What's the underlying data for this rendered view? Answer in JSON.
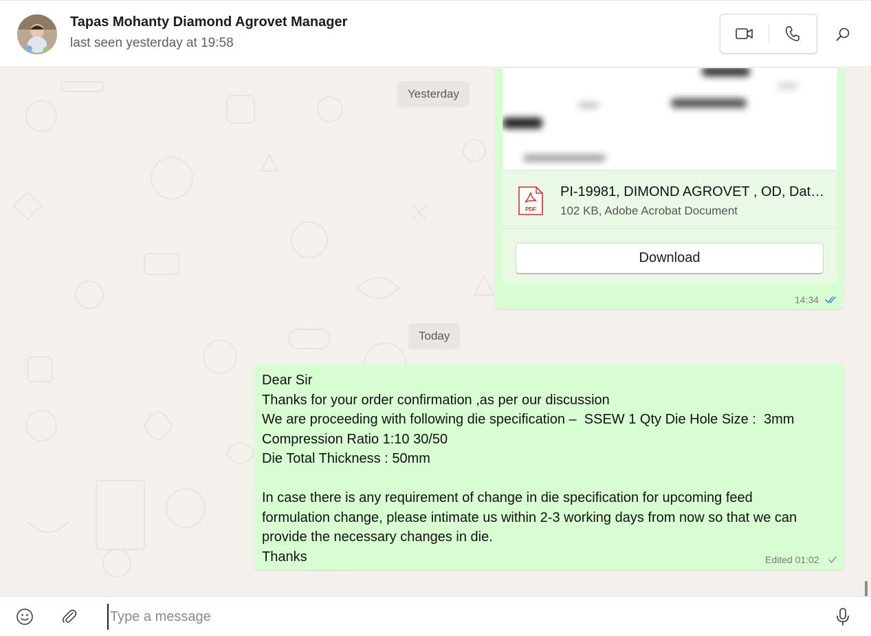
{
  "header": {
    "contact_name": "Tapas Mohanty Diamond Agrovet Manager",
    "status": "last seen yesterday at 19:58",
    "icons": [
      "video-call-icon",
      "voice-call-icon",
      "search-icon"
    ]
  },
  "chat": {
    "date_yesterday": "Yesterday",
    "date_today": "Today",
    "document_message": {
      "file_name": "PI-19981, DIMOND AGROVET , OD, Dat…",
      "file_meta": "102 KB, Adobe Acrobat Document",
      "file_icon_label": "PDF",
      "download_label": "Download",
      "time": "14:34",
      "status": "read"
    },
    "text_message": {
      "text": "Dear Sir\nThanks for your order confirmation ,as per our discussion\nWe are proceeding with following die specification –  SSEW 1 Qty Die Hole Size :  3mm\nCompression Ratio 1:10 30/50\nDie Total Thickness : 50mm\n\nIn case there is any requirement of change in die specification for upcoming feed\nformulation change, please intimate us within 2-3 working days from now so that we can\nprovide the necessary changes in die.\nThanks",
      "time": "Edited 01:02",
      "status": "sent"
    }
  },
  "composer": {
    "placeholder": "Type a message",
    "value": "",
    "icons": [
      "emoji-icon",
      "attach-icon",
      "microphone-icon"
    ]
  },
  "colors": {
    "outgoing_bubble": "#d9fdd3",
    "read_tick": "#2f8fd4",
    "header_bg": "#ffffff",
    "chat_bg": "#f4f1ec"
  }
}
